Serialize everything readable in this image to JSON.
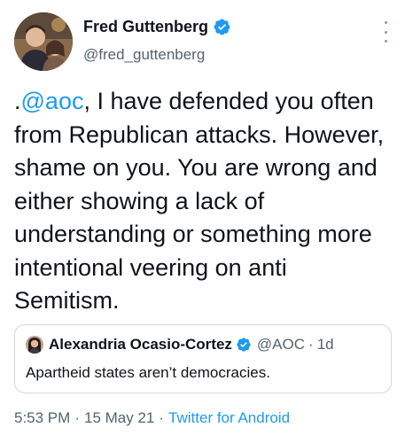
{
  "author": {
    "display_name": "Fred Guttenberg",
    "handle": "@fred_guttenberg",
    "verified": true,
    "avatar_icon": "profile-photo"
  },
  "more_icon": "more-options-icon",
  "tweet": {
    "prefix": ".",
    "mention": "@aoc",
    "body": ", I have defended you often from Republican attacks. However, shame on you.  You are wrong and either showing a lack of understanding or something more intentional veering on anti Semitism."
  },
  "quoted_tweet": {
    "display_name": "Alexandria Ocasio-Cortez",
    "handle": "@AOC",
    "separator": "·",
    "time": "1d",
    "verified": true,
    "text": "Apartheid states aren’t democracies."
  },
  "meta": {
    "time": "5:53 PM",
    "separator": "·",
    "date": "15 May 21",
    "source": "Twitter for Android"
  },
  "colors": {
    "link": "#1d9bf0",
    "secondary_text": "#536471",
    "border": "#cfd9de"
  }
}
